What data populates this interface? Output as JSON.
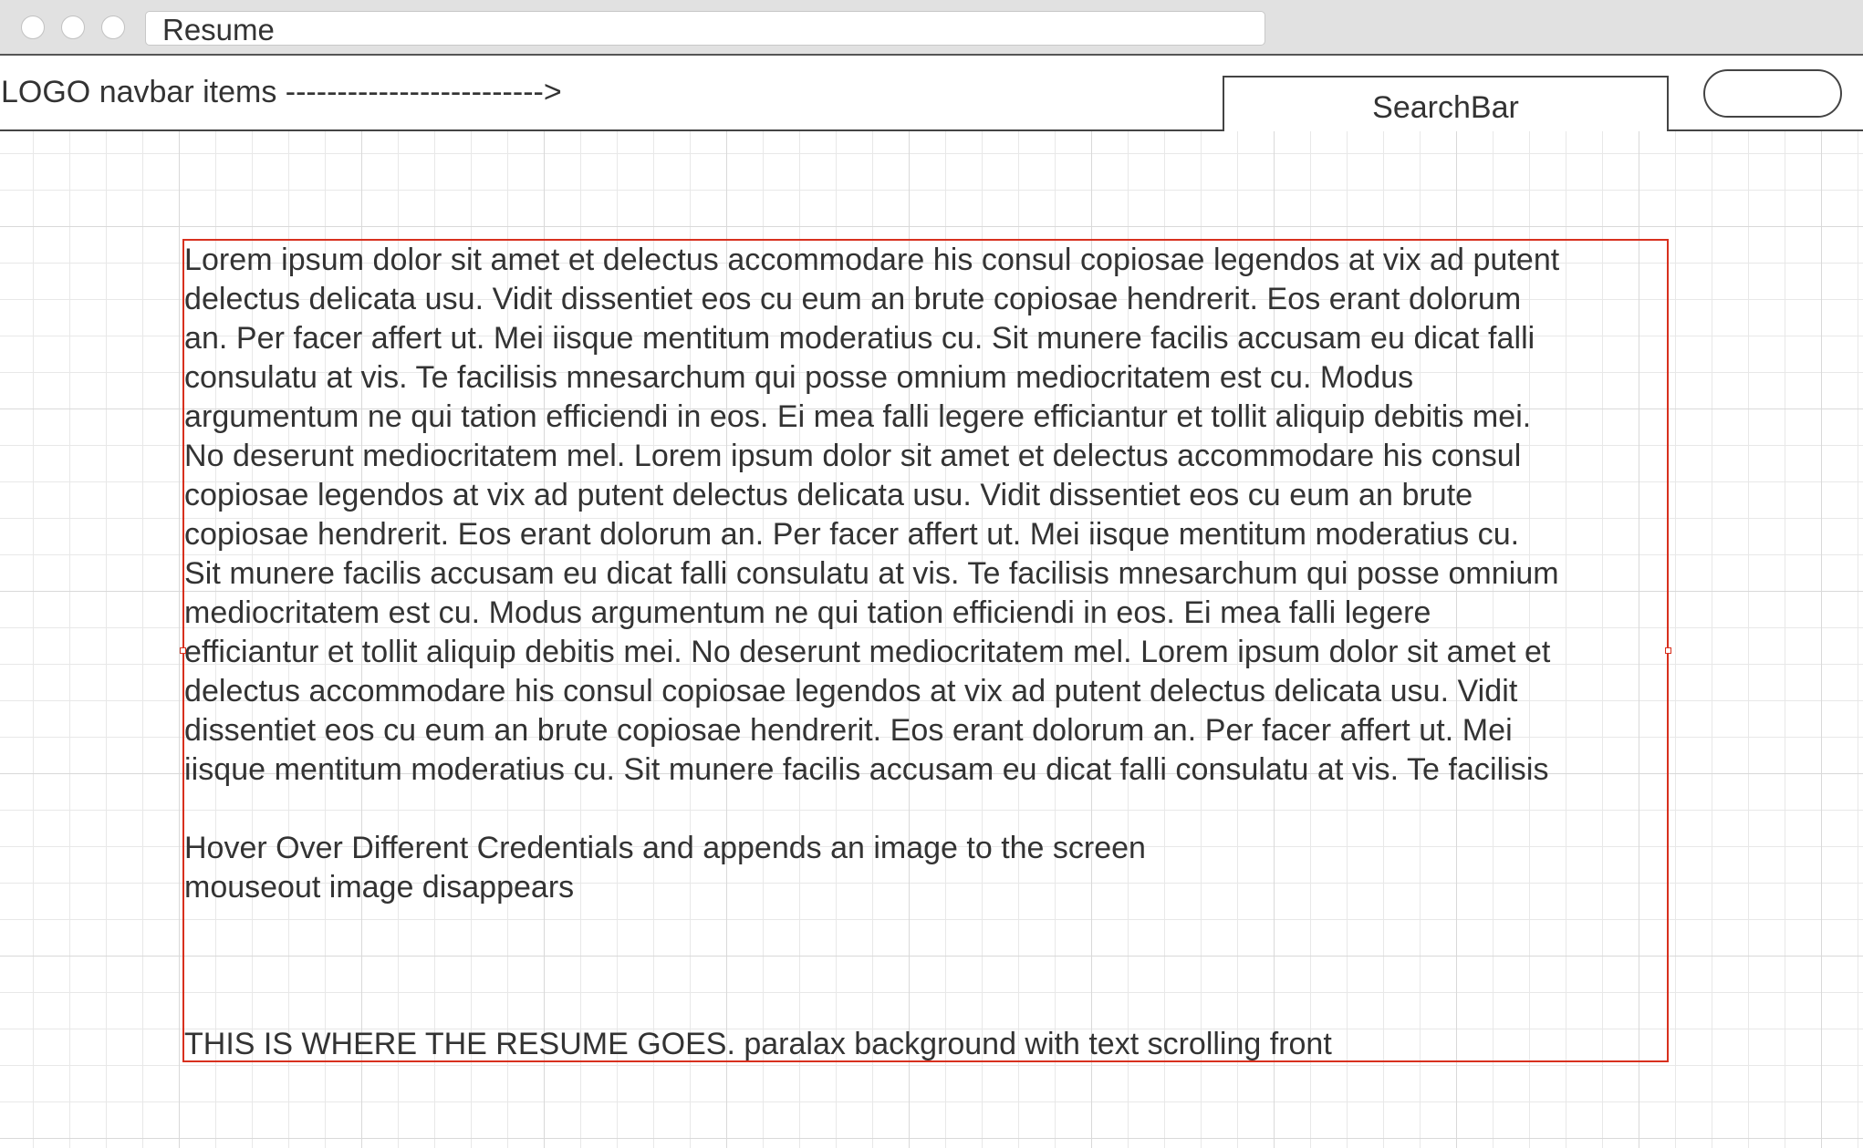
{
  "window": {
    "address_bar_text": "Resume"
  },
  "navbar": {
    "logo_text": "LOGO navbar items ------------------------->",
    "search_label": "SearchBar",
    "button_label": ""
  },
  "content": {
    "lorem_lines": [
      "Lorem ipsum dolor sit amet et delectus accommodare his consul copiosae legendos at vix ad putent",
      "delectus delicata usu. Vidit dissentiet eos cu eum an brute copiosae hendrerit. Eos erant dolorum",
      "an. Per facer affert ut. Mei iisque mentitum moderatius cu. Sit munere facilis accusam eu dicat falli",
      "consulatu at vis. Te facilisis mnesarchum qui posse omnium mediocritatem est cu. Modus",
      "argumentum ne qui tation efficiendi in eos. Ei mea falli legere efficiantur et tollit aliquip debitis mei.",
      "No deserunt mediocritatem mel. Lorem ipsum dolor sit amet et delectus accommodare his consul",
      "copiosae legendos at vix ad putent delectus delicata usu. Vidit dissentiet eos cu eum an brute",
      "copiosae hendrerit. Eos erant dolorum an. Per facer affert ut. Mei iisque mentitum moderatius cu.",
      "Sit munere facilis accusam eu dicat falli consulatu at vis. Te facilisis mnesarchum qui posse omnium",
      "mediocritatem est cu. Modus argumentum ne qui tation efficiendi in eos. Ei mea falli legere",
      "efficiantur et tollit aliquip debitis mei. No deserunt mediocritatem mel. Lorem ipsum dolor sit amet et",
      "delectus accommodare his consul copiosae legendos at vix ad putent delectus delicata usu. Vidit",
      "dissentiet eos cu eum an brute copiosae hendrerit. Eos erant dolorum an. Per facer affert ut. Mei",
      "iisque mentitum moderatius cu. Sit munere facilis accusam eu dicat falli consulatu at vis. Te facilisis"
    ],
    "hover_note": "Hover Over Different Credentials and appends an image to the screen",
    "mouseout_note": "mouseout image disappears",
    "resume_note": "THIS IS WHERE THE RESUME GOES. paralax background with text scrolling front"
  },
  "colors": {
    "selection_border": "#d8301e",
    "chrome_background": "#e1e1e1",
    "text": "#333333"
  }
}
